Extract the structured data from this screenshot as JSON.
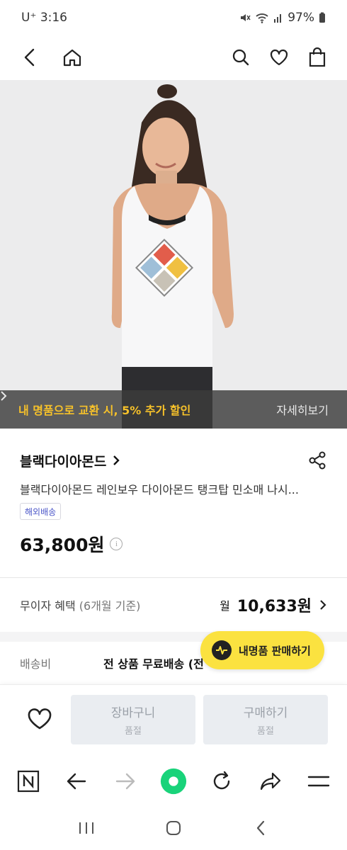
{
  "status_bar": {
    "carrier_time": "U⁺ 3:16",
    "battery": "97%"
  },
  "header": {
    "icons": [
      "back-icon",
      "home-icon",
      "search-icon",
      "heart-icon",
      "shopping-bag-icon"
    ]
  },
  "promo": {
    "text": "내 명품으로 교환 시, 5% 추가 할인",
    "link": "자세히보기",
    "accent_color": "#f6c12a"
  },
  "product": {
    "brand": "블랙다이아몬드",
    "title": "블랙다이아몬드 레인보우 다이아몬드 탱크탑 민소매 나시...",
    "badge": "해외배송",
    "price": "63,800원"
  },
  "installment": {
    "label": "무이자 혜택",
    "sub": "(6개월 기준)",
    "prefix": "월",
    "amount": "10,633원"
  },
  "shipping": {
    "label": "배송비",
    "value": "전 상품 무료배송 (전"
  },
  "fab": {
    "label": "내명품 판매하기",
    "color": "#fbe240"
  },
  "actions": {
    "cart_label": "장바구니",
    "cart_sub": "품절",
    "buy_label": "구매하기",
    "buy_sub": "품절"
  },
  "browser": {
    "accent": "#19d37a"
  }
}
